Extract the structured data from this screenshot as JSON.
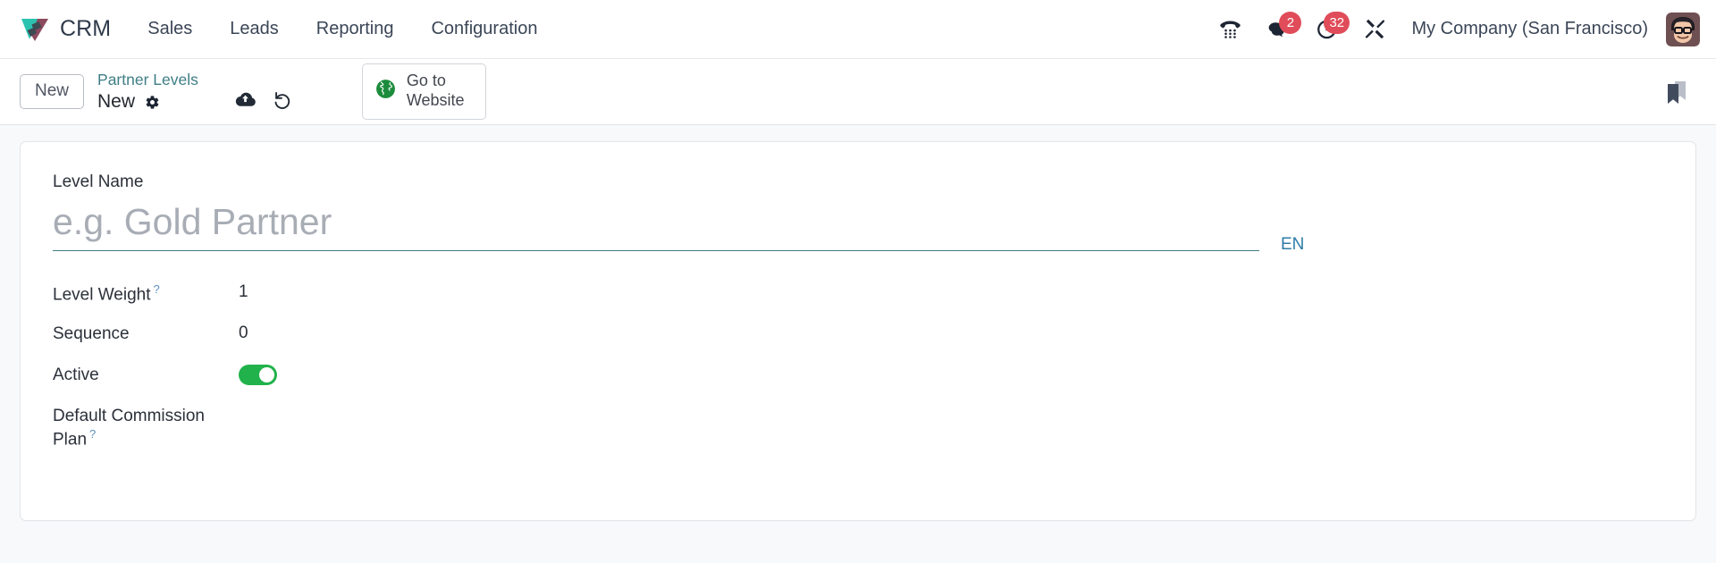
{
  "navbar": {
    "brand": {
      "name": "CRM",
      "logo_icon": "odoo-crm-logo-icon",
      "colors": {
        "teal": "#22c3b0",
        "maroon": "#8c4a5e"
      }
    },
    "menu_items": [
      {
        "label": "Sales"
      },
      {
        "label": "Leads"
      },
      {
        "label": "Reporting"
      },
      {
        "label": "Configuration"
      }
    ],
    "systray": [
      {
        "name": "voip-dialpad-icon",
        "badge": null
      },
      {
        "name": "messages-icon",
        "badge": "2"
      },
      {
        "name": "activities-clock-icon",
        "badge": "32"
      },
      {
        "name": "debug-tools-icon",
        "badge": null
      }
    ],
    "company": "My Company (San Francisco)",
    "avatar_icon": "user-avatar"
  },
  "control_panel": {
    "new_button": "New",
    "breadcrumb": {
      "parent": "Partner Levels",
      "current": "New",
      "gear_icon": "gear-icon"
    },
    "record_actions": [
      {
        "name": "save-cloud-icon",
        "title": "Save manually"
      },
      {
        "name": "discard-undo-icon",
        "title": "Discard changes"
      }
    ],
    "website_button": {
      "label": "Go to Website",
      "icon": "globe-icon",
      "icon_color": "#1c8c3c"
    },
    "bookmark_icon": "bookmark-icon"
  },
  "form": {
    "name_field": {
      "label": "Level Name",
      "placeholder": "e.g. Gold Partner",
      "value": "",
      "lang_badge": "EN",
      "underline_color": "#3f7e86"
    },
    "rows": [
      {
        "label": "Level Weight",
        "tooltip": "?",
        "value": "1",
        "type": "text"
      },
      {
        "label": "Sequence",
        "tooltip": "",
        "value": "0",
        "type": "text"
      },
      {
        "label": "Active",
        "tooltip": "",
        "value": "on",
        "type": "toggle",
        "toggle_color": "#21b24b"
      },
      {
        "label": "Default Commission Plan",
        "tooltip": "?",
        "value": "",
        "type": "text"
      }
    ]
  }
}
